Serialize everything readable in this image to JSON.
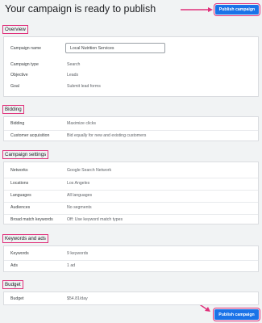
{
  "header": {
    "title": "Your campaign is ready to publish",
    "publish_label": "Publish campaign"
  },
  "overview": {
    "heading": "Overview",
    "campaign_name_label": "Campaign name",
    "campaign_name_value": "Local Nutrition Services",
    "campaign_type_label": "Campaign type",
    "campaign_type_value": "Search",
    "objective_label": "Objective",
    "objective_value": "Leads",
    "goal_label": "Goal",
    "goal_value": "Submit lead forms"
  },
  "bidding": {
    "heading": "Bidding",
    "bidding_label": "Bidding",
    "bidding_value": "Maximize clicks",
    "acquisition_label": "Customer acquisition",
    "acquisition_value": "Bid equally for new and existing customers"
  },
  "campaign_settings": {
    "heading": "Campaign settings",
    "networks_label": "Networks",
    "networks_value": "Google Search Network",
    "locations_label": "Locations",
    "locations_value": "Los Angeles",
    "languages_label": "Languages",
    "languages_value": "All languages",
    "audiences_label": "Audiences",
    "audiences_value": "No segments",
    "broad_match_label": "Broad match keywords",
    "broad_match_value": "Off: Use keyword match types"
  },
  "keywords_ads": {
    "heading": "Keywords and ads",
    "keywords_label": "Keywords",
    "keywords_value": "9 keywords",
    "ads_label": "Ads",
    "ads_value": "1 ad"
  },
  "budget": {
    "heading": "Budget",
    "budget_label": "Budget",
    "budget_value": "$54.81/day"
  },
  "footer": {
    "publish_label": "Publish campaign"
  },
  "colors": {
    "accent": "#1a73e8",
    "highlight": "#e0307a",
    "background": "#f1f3f4"
  }
}
